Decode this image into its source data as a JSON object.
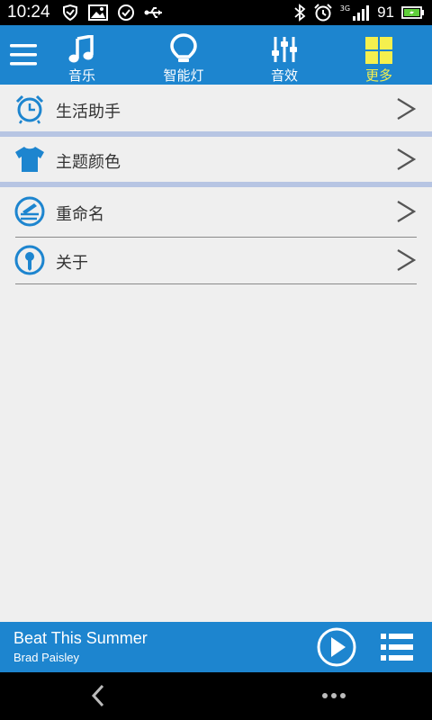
{
  "status_bar": {
    "time": "10:24",
    "signal_label": "3G",
    "battery": "91"
  },
  "top_nav": {
    "tabs": [
      {
        "label": "音乐",
        "icon": "music-note-icon"
      },
      {
        "label": "智能灯",
        "icon": "bulb-icon"
      },
      {
        "label": "音效",
        "icon": "equalizer-icon"
      },
      {
        "label": "更多",
        "icon": "grid-icon",
        "active": true
      }
    ],
    "active_color": "#f5f04e",
    "bar_color": "#1d85cf"
  },
  "menu": {
    "items": [
      {
        "label": "生活助手",
        "icon": "alarm-clock-icon"
      },
      {
        "label": "主题颜色",
        "icon": "tshirt-icon"
      },
      {
        "label": "重命名",
        "icon": "rename-icon"
      },
      {
        "label": "关于",
        "icon": "info-icon"
      }
    ],
    "chevron": ">"
  },
  "player": {
    "song": "Beat This Summer",
    "artist": "Brad Paisley"
  }
}
